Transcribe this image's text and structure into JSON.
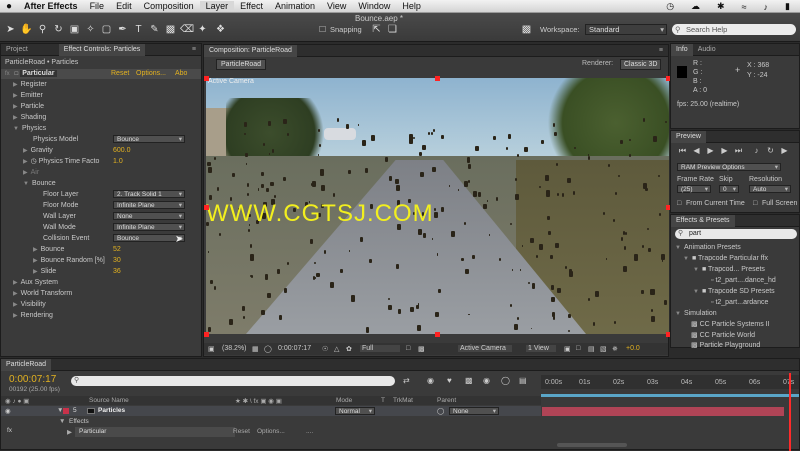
{
  "menu": {
    "apple": "",
    "app": "After Effects",
    "items": [
      "File",
      "Edit",
      "Composition",
      "Layer",
      "Effect",
      "Animation",
      "View",
      "Window",
      "Help"
    ],
    "right_icons": [
      "clock-icon",
      "cloud-icon",
      "bluetooth-icon",
      "wifi-icon",
      "speaker-icon",
      "battery-icon"
    ]
  },
  "window_title": "Bounce.aep *",
  "toolbar": {
    "snapping": "Snapping",
    "workspace_label": "Workspace:",
    "workspace_value": "Standard",
    "search_placeholder": "Search Help"
  },
  "left_panel": {
    "tab_project": "Project",
    "tab_effect_controls": "Effect Controls: Particles",
    "breadcrumb": "ParticleRoad • Particles",
    "effect_name": "Particular",
    "reset": "Reset",
    "options": "Options...",
    "about": "Abo",
    "rows": {
      "register": "Register",
      "emitter": "Emitter",
      "particle": "Particle",
      "shading": "Shading",
      "physics": "Physics",
      "physics_model": "Physics Model",
      "physics_model_val": "Bounce",
      "gravity": "Gravity",
      "gravity_val": "600.0",
      "time_factor": "Physics Time Facto",
      "time_factor_val": "1.0",
      "air": "Air",
      "bounce": "Bounce",
      "floor_layer": "Floor Layer",
      "floor_layer_val": "2. Track Solid 1",
      "floor_mode": "Floor Mode",
      "floor_mode_val": "Infinite Plane",
      "wall_layer": "Wall Layer",
      "wall_layer_val": "None",
      "wall_mode": "Wall Mode",
      "wall_mode_val": "Infinite Plane",
      "collision_event": "Collision Event",
      "collision_event_val": "Bounce",
      "bounce_p": "Bounce",
      "bounce_p_val": "52",
      "bounce_random": "Bounce Random [%]",
      "bounce_random_val": "30",
      "slide": "Slide",
      "slide_val": "36",
      "aux_system": "Aux System",
      "world_transform": "World Transform",
      "visibility": "Visibility",
      "rendering": "Rendering"
    }
  },
  "comp": {
    "tab": "Composition: ParticleRoad",
    "comp_name": "ParticleRoad",
    "renderer_label": "Renderer:",
    "renderer_value": "Classic 3D",
    "active_camera_label": "Active Camera",
    "watermark": "WWW.CGTSJ.COM",
    "zoom": "(38.2%)",
    "timecode": "0:00:07:17",
    "resolution": "Full",
    "camera": "Active Camera",
    "views": "1 View",
    "exposure": "+0.0"
  },
  "info": {
    "tab_info": "Info",
    "tab_audio": "Audio",
    "r": "R :",
    "g": "G :",
    "b": "B :",
    "a": "A : 0",
    "x": "X : 368",
    "y": "Y : -24",
    "fps": "fps: 25.00 (realtime)"
  },
  "preview": {
    "title": "Preview",
    "ram_options": "RAM Preview Options",
    "frame_rate_label": "Frame Rate",
    "skip_label": "Skip",
    "resolution_label": "Resolution",
    "frame_rate_val": "(25)",
    "skip_val": "0",
    "resolution_val": "Auto",
    "from_current_time": "From Current Time",
    "full_screen": "Full Screen"
  },
  "effects_presets": {
    "title": "Effects & Presets",
    "search_value": "part",
    "items": [
      "Animation Presets",
      "Trapcode Particular ffx",
      "Trapcod... Presets",
      "t2_part....dance_hd",
      "Trapcode SD Presets",
      "t2_part...ardance",
      "Simulation",
      "CC Particle Systems II",
      "CC Particle World",
      "Particle Playground"
    ]
  },
  "timeline": {
    "tab": "ParticleRoad",
    "timecode": "0:00:07:17",
    "frames": "00192 (25.00 fps)",
    "search_placeholder": "",
    "col_source": "Source Name",
    "col_mode": "Mode",
    "col_t": "T",
    "col_trkmat": "TrkMat",
    "col_parent": "Parent",
    "layer_num": "5",
    "layer_name": "Particles",
    "layer_mode": "Normal",
    "layer_parent": "None",
    "effects": "Effects",
    "effect_item": "Particular",
    "reset": "Reset",
    "options": "Options...",
    "dots": "....",
    "ruler": [
      "0:00s",
      "01s",
      "02s",
      "03s",
      "04s",
      "05s",
      "06s",
      "07s"
    ],
    "current_time": 0.96
  }
}
